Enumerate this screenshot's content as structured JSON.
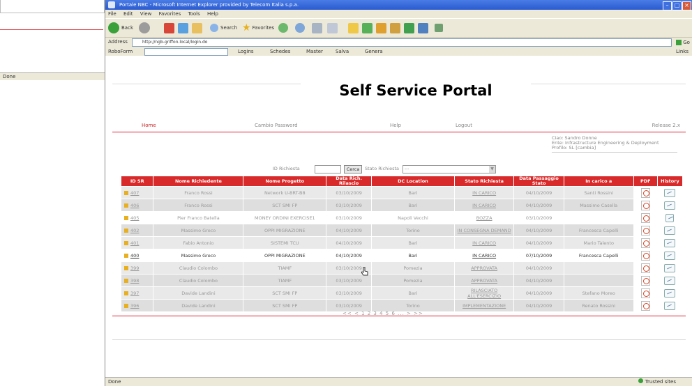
{
  "background_window": {
    "status_text": "Done"
  },
  "window": {
    "title": "Portale NBC - Microsoft Internet Explorer provided by Telecom Italia s.p.a.",
    "menu": [
      "File",
      "Edit",
      "View",
      "Favorites",
      "Tools",
      "Help"
    ],
    "toolbar": {
      "back_label": "Back",
      "search_label": "Search",
      "favorites_label": "Favorites"
    },
    "address": {
      "label": "Address",
      "url": "http://ngb-griffon.local/login.do",
      "go_label": "Go"
    },
    "links": {
      "label": "RoboForm",
      "items": [
        "Logins",
        "Schedes",
        "Master",
        "Salva",
        "Genera"
      ],
      "right_label": "Links"
    },
    "status": {
      "left": "Done",
      "right": "Trusted sites"
    }
  },
  "page": {
    "brand": "Self Service Portal",
    "nav": {
      "home": "Home",
      "cambio_password": "Cambio Password",
      "help": "Help",
      "logout": "Logout",
      "release": "Release 2.x"
    },
    "user_info": {
      "line1": "Ciao: Sandro Donne",
      "line2": "Ente: Infrastructure Engineering & Deployment",
      "line3": "Profilo: SL   [cambia]"
    },
    "filter": {
      "id_label": "ID Richiesta",
      "search_button": "Cerca",
      "state_label": "Stato Richiesta",
      "state_value": "---"
    },
    "table": {
      "headers": [
        "ID SR",
        "Nome Richiedente",
        "Nome Progetto",
        "Data Rich. Rilascio",
        "DC Location",
        "Stato Richiesta",
        "Data Passaggio Stato",
        "In carico a",
        "PDF",
        "History"
      ],
      "rows": [
        {
          "id": "407",
          "richiedente": "Franco Rossi",
          "progetto": "Network U-BRT-B8",
          "data_rich": "03/10/2009",
          "dc": "Bari",
          "stato": "IN CARICO",
          "data_pass": "04/10/2009",
          "carico": "Santi Rossini"
        },
        {
          "id": "406",
          "richiedente": "Franco Rossi",
          "progetto": "SCT SMI FP",
          "data_rich": "03/10/2009",
          "dc": "Bari",
          "stato": "IN CARICO",
          "data_pass": "04/10/2009",
          "carico": "Massimo Casella"
        },
        {
          "id": "405",
          "richiedente": "Pier Franco Batella",
          "progetto": "MONEY ORDINI EXERCISE1",
          "data_rich": "03/10/2009",
          "dc": "Napoli Vecchi",
          "stato": "BOZZA",
          "data_pass": "03/10/2009",
          "carico": ""
        },
        {
          "id": "402",
          "richiedente": "Massimo Greco",
          "progetto": "OPPI MIGRAZIONE",
          "data_rich": "04/10/2009",
          "dc": "Torino",
          "stato": "IN CONSEGNA DEMAND",
          "data_pass": "04/10/2009",
          "carico": "Francesca Capelli"
        },
        {
          "id": "401",
          "richiedente": "Fabio Antonio",
          "progetto": "SISTEMI TCU",
          "data_rich": "04/10/2009",
          "dc": "Bari",
          "stato": "IN CARICO",
          "data_pass": "04/10/2009",
          "carico": "Mario Talento"
        },
        {
          "id": "400",
          "richiedente": "Massimo Greco",
          "progetto": "OPPI MIGRAZIONE",
          "data_rich": "04/10/2009",
          "dc": "Bari",
          "stato": "IN CARICO",
          "data_pass": "07/10/2009",
          "carico": "Francesca Capelli"
        },
        {
          "id": "399",
          "richiedente": "Claudio Colombo",
          "progetto": "TIAMF",
          "data_rich": "03/10/2009",
          "dc": "Pomezia",
          "stato": "APPROVATA",
          "data_pass": "04/10/2009",
          "carico": ""
        },
        {
          "id": "398",
          "richiedente": "Claudio Colombo",
          "progetto": "TIAMF",
          "data_rich": "03/10/2009",
          "dc": "Pomezia",
          "stato": "APPROVATA",
          "data_pass": "04/10/2009",
          "carico": ""
        },
        {
          "id": "397",
          "richiedente": "Davide Landini",
          "progetto": "SCT SMI FP",
          "data_rich": "03/10/2009",
          "dc": "Bari",
          "stato": "RILASCIATO ALL'ESERCIZIO",
          "data_pass": "04/10/2009",
          "carico": "Stefano Moreo"
        },
        {
          "id": "396",
          "richiedente": "Davide Landini",
          "progetto": "SCT SMI FP",
          "data_rich": "03/10/2009",
          "dc": "Torino",
          "stato": "IMPLEMENTAZIONE",
          "data_pass": "04/10/2009",
          "carico": "Renato Rossini"
        }
      ]
    },
    "pager": "<< < 1 2 3 4 5 6 ... > >>"
  },
  "colors": {
    "accent": "#d82a2a",
    "titlebar": "#2a5bd0",
    "chrome": "#ece9d8"
  }
}
